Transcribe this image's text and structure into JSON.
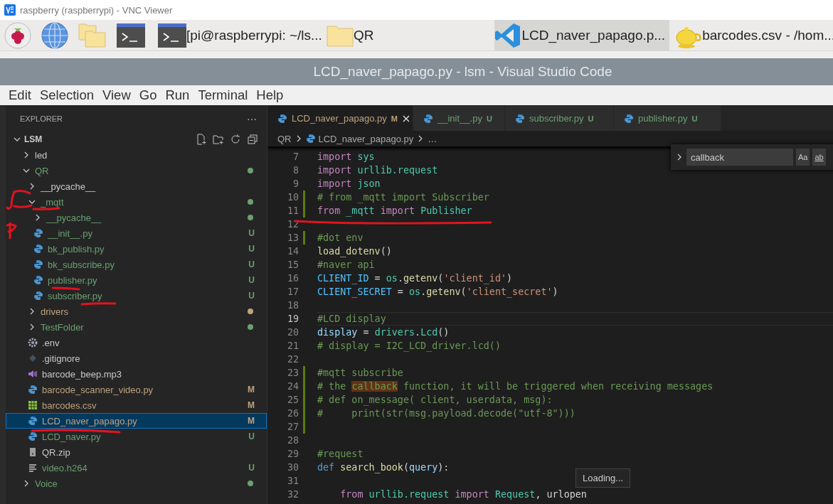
{
  "viewer": {
    "title": "raspberry (raspberrypi) - VNC Viewer"
  },
  "taskbar": {
    "windows": [
      {
        "kind": "terminal",
        "label": "[pi@raspberrypi: ~/ls...",
        "selected": false
      },
      {
        "kind": "folder",
        "label": "QR",
        "selected": false
      },
      {
        "kind": "editor",
        "label": "LCD_naver_papago.p...",
        "selected": true
      },
      {
        "kind": "notes",
        "label": "barcodes.csv - /hom...",
        "selected": false
      }
    ]
  },
  "window": {
    "title": "LCD_naver_papago.py - lsm - Visual Studio Code"
  },
  "menu": [
    "Edit",
    "Selection",
    "View",
    "Go",
    "Run",
    "Terminal",
    "Help"
  ],
  "sidebar": {
    "title": "EXPLORER",
    "more": "···",
    "root": {
      "label": "LSM",
      "expanded": true
    },
    "items": [
      {
        "label": "led",
        "kind": "folder",
        "expanded": false,
        "color": "#c8c8c8"
      },
      {
        "label": "QR",
        "kind": "folder",
        "expanded": true,
        "color": "#6ba070",
        "dot": true,
        "children": [
          {
            "label": "__pycache__",
            "kind": "folder",
            "expanded": false,
            "color": "#c8c8c8"
          },
          {
            "label": "_mqtt",
            "kind": "folder",
            "expanded": true,
            "color": "#6ba070",
            "dot": true,
            "children": [
              {
                "label": "__pycache__",
                "kind": "folder",
                "expanded": false,
                "color": "#6ba070",
                "dot": true
              },
              {
                "label": "__init__.py",
                "kind": "python",
                "color": "#6ba070",
                "badge": "U"
              },
              {
                "label": "bk_publish.py",
                "kind": "python",
                "color": "#6ba070",
                "badge": "U"
              },
              {
                "label": "bk_subscribe.py",
                "kind": "python",
                "color": "#6ba070",
                "badge": "U"
              },
              {
                "label": "publisher.py",
                "kind": "python",
                "color": "#6ba070",
                "badge": "U"
              },
              {
                "label": "subscriber.py",
                "kind": "python",
                "color": "#6ba070",
                "badge": "U"
              }
            ]
          },
          {
            "label": "drivers",
            "kind": "folder",
            "expanded": false,
            "color": "#bfa27c",
            "dot": true
          },
          {
            "label": "TestFolder",
            "kind": "folder",
            "expanded": false,
            "color": "#6ba070",
            "dot": true
          },
          {
            "label": ".env",
            "kind": "settings",
            "color": "#c8c8c8"
          },
          {
            "label": ".gitignore",
            "kind": "git",
            "color": "#c8c8c8"
          },
          {
            "label": "barcode_beep.mp3",
            "kind": "audio",
            "color": "#c8c8c8"
          },
          {
            "label": "barcode_scanner_video.py",
            "kind": "python",
            "color": "#bfa27c",
            "badge": "M"
          },
          {
            "label": "barcodes.csv",
            "kind": "csv",
            "color": "#bfa27c",
            "badge": "M"
          },
          {
            "label": "LCD_naver_papago.py",
            "kind": "python",
            "color": "#bfa27c",
            "badge": "M",
            "selected": true
          },
          {
            "label": "LCD_naver.py",
            "kind": "python",
            "color": "#6ba070",
            "badge": "U"
          },
          {
            "label": "QR.zip",
            "kind": "zip",
            "color": "#c8c8c8"
          },
          {
            "label": "video.h264",
            "kind": "text",
            "color": "#6ba070",
            "badge": "U"
          }
        ]
      },
      {
        "label": "Voice",
        "kind": "folder",
        "expanded": false,
        "color": "#6ba070",
        "dot": true
      }
    ]
  },
  "tabs": [
    {
      "label": "LCD_naver_papago.py",
      "status": "M",
      "color": "#bfa27c",
      "selected": true
    },
    {
      "label": "__init__.py",
      "status": "U",
      "color": "#6ba070",
      "selected": false
    },
    {
      "label": "subscriber.py",
      "status": "U",
      "color": "#6ba070",
      "selected": false
    },
    {
      "label": "publisher.py",
      "status": "U",
      "color": "#6ba070",
      "selected": false
    }
  ],
  "breadcrumbs": [
    {
      "label": "QR",
      "kind": "folder"
    },
    {
      "label": "LCD_naver_papago.py",
      "kind": "python"
    },
    {
      "label": "…",
      "kind": "more"
    }
  ],
  "code": [
    {
      "number": "7",
      "tokens": [
        {
          "kind": "control",
          "text": "import "
        },
        {
          "kind": "module",
          "text": "sys"
        }
      ]
    },
    {
      "number": "8",
      "tokens": [
        {
          "kind": "control",
          "text": "import "
        },
        {
          "kind": "module",
          "text": "urllib.request"
        }
      ]
    },
    {
      "number": "9",
      "tokens": [
        {
          "kind": "control",
          "text": "import "
        },
        {
          "kind": "module",
          "text": "json"
        }
      ]
    },
    {
      "number": "10",
      "changed": true,
      "tokens": [
        {
          "kind": "comment",
          "text": "# from _mqtt import Subscriber"
        }
      ]
    },
    {
      "number": "11",
      "changed": true,
      "tokens": [
        {
          "kind": "control",
          "text": "from "
        },
        {
          "kind": "module",
          "text": "_mqtt "
        },
        {
          "kind": "control",
          "text": "import "
        },
        {
          "kind": "module",
          "text": "Publisher"
        }
      ]
    },
    {
      "number": "12"
    },
    {
      "number": "13",
      "changed": true,
      "tokens": [
        {
          "kind": "comment",
          "text": "#dot env"
        }
      ]
    },
    {
      "number": "14",
      "tokens": [
        {
          "kind": "function",
          "text": "load_dotenv"
        },
        {
          "kind": "plain",
          "text": "()"
        }
      ]
    },
    {
      "number": "15",
      "tokens": [
        {
          "kind": "comment",
          "text": "#naver api"
        }
      ]
    },
    {
      "number": "16",
      "tokens": [
        {
          "kind": "constant",
          "text": "CLIENT_ID"
        },
        {
          "kind": "plain",
          "text": " = "
        },
        {
          "kind": "module",
          "text": "os"
        },
        {
          "kind": "plain",
          "text": "."
        },
        {
          "kind": "function",
          "text": "getenv"
        },
        {
          "kind": "plain",
          "text": "("
        },
        {
          "kind": "string",
          "text": "'client_id'"
        },
        {
          "kind": "plain",
          "text": ")"
        }
      ]
    },
    {
      "number": "17",
      "tokens": [
        {
          "kind": "constant",
          "text": "CLIENT_SECRET"
        },
        {
          "kind": "plain",
          "text": " = "
        },
        {
          "kind": "module",
          "text": "os"
        },
        {
          "kind": "plain",
          "text": "."
        },
        {
          "kind": "function",
          "text": "getenv"
        },
        {
          "kind": "plain",
          "text": "("
        },
        {
          "kind": "string",
          "text": "'client_secret'"
        },
        {
          "kind": "plain",
          "text": ")"
        }
      ]
    },
    {
      "number": "18"
    },
    {
      "number": "19",
      "current": true,
      "tokens": [
        {
          "kind": "comment",
          "text": "#LCD display"
        }
      ]
    },
    {
      "number": "20",
      "tokens": [
        {
          "kind": "variable",
          "text": "display"
        },
        {
          "kind": "plain",
          "text": " = "
        },
        {
          "kind": "module",
          "text": "drivers"
        },
        {
          "kind": "plain",
          "text": "."
        },
        {
          "kind": "module",
          "text": "Lcd"
        },
        {
          "kind": "plain",
          "text": "()"
        }
      ]
    },
    {
      "number": "21",
      "tokens": [
        {
          "kind": "comment",
          "text": "# display = I2C_LCD_driver.lcd()"
        }
      ]
    },
    {
      "number": "22"
    },
    {
      "number": "23",
      "changed": true,
      "tokens": [
        {
          "kind": "comment",
          "text": "#mqtt subscribe"
        }
      ]
    },
    {
      "number": "24",
      "changed": true,
      "tokens": [
        {
          "kind": "comment",
          "text": "# the "
        },
        {
          "kind": "match",
          "text": "callback"
        },
        {
          "kind": "comment",
          "text": " function, it will be triggered when receiving messages"
        }
      ]
    },
    {
      "number": "25",
      "changed": true,
      "tokens": [
        {
          "kind": "comment",
          "text": "# def on_message( client, userdata, msg):"
        }
      ]
    },
    {
      "number": "26",
      "changed": true,
      "tokens": [
        {
          "kind": "comment",
          "text": "#     print(str(msg.payload.decode(\"utf-8\")))"
        }
      ]
    },
    {
      "number": "27",
      "changed": true
    },
    {
      "number": "28"
    },
    {
      "number": "29",
      "tokens": [
        {
          "kind": "comment",
          "text": "#request"
        }
      ]
    },
    {
      "number": "30",
      "tokens": [
        {
          "kind": "storage",
          "text": "def "
        },
        {
          "kind": "function",
          "text": "search_book"
        },
        {
          "kind": "plain",
          "text": "("
        },
        {
          "kind": "variable",
          "text": "query"
        },
        {
          "kind": "plain",
          "text": "):"
        }
      ]
    },
    {
      "number": "31"
    },
    {
      "number": "32",
      "tokens": [
        {
          "kind": "control",
          "text": "    from "
        },
        {
          "kind": "module",
          "text": "urllib.request "
        },
        {
          "kind": "control",
          "text": "import "
        },
        {
          "kind": "module",
          "text": "Request"
        },
        {
          "kind": "plain",
          "text": ", urlopen"
        }
      ]
    }
  ],
  "find": {
    "value": "callback",
    "options": [
      "Aa",
      "ab"
    ]
  },
  "tooltip": "Loading..."
}
